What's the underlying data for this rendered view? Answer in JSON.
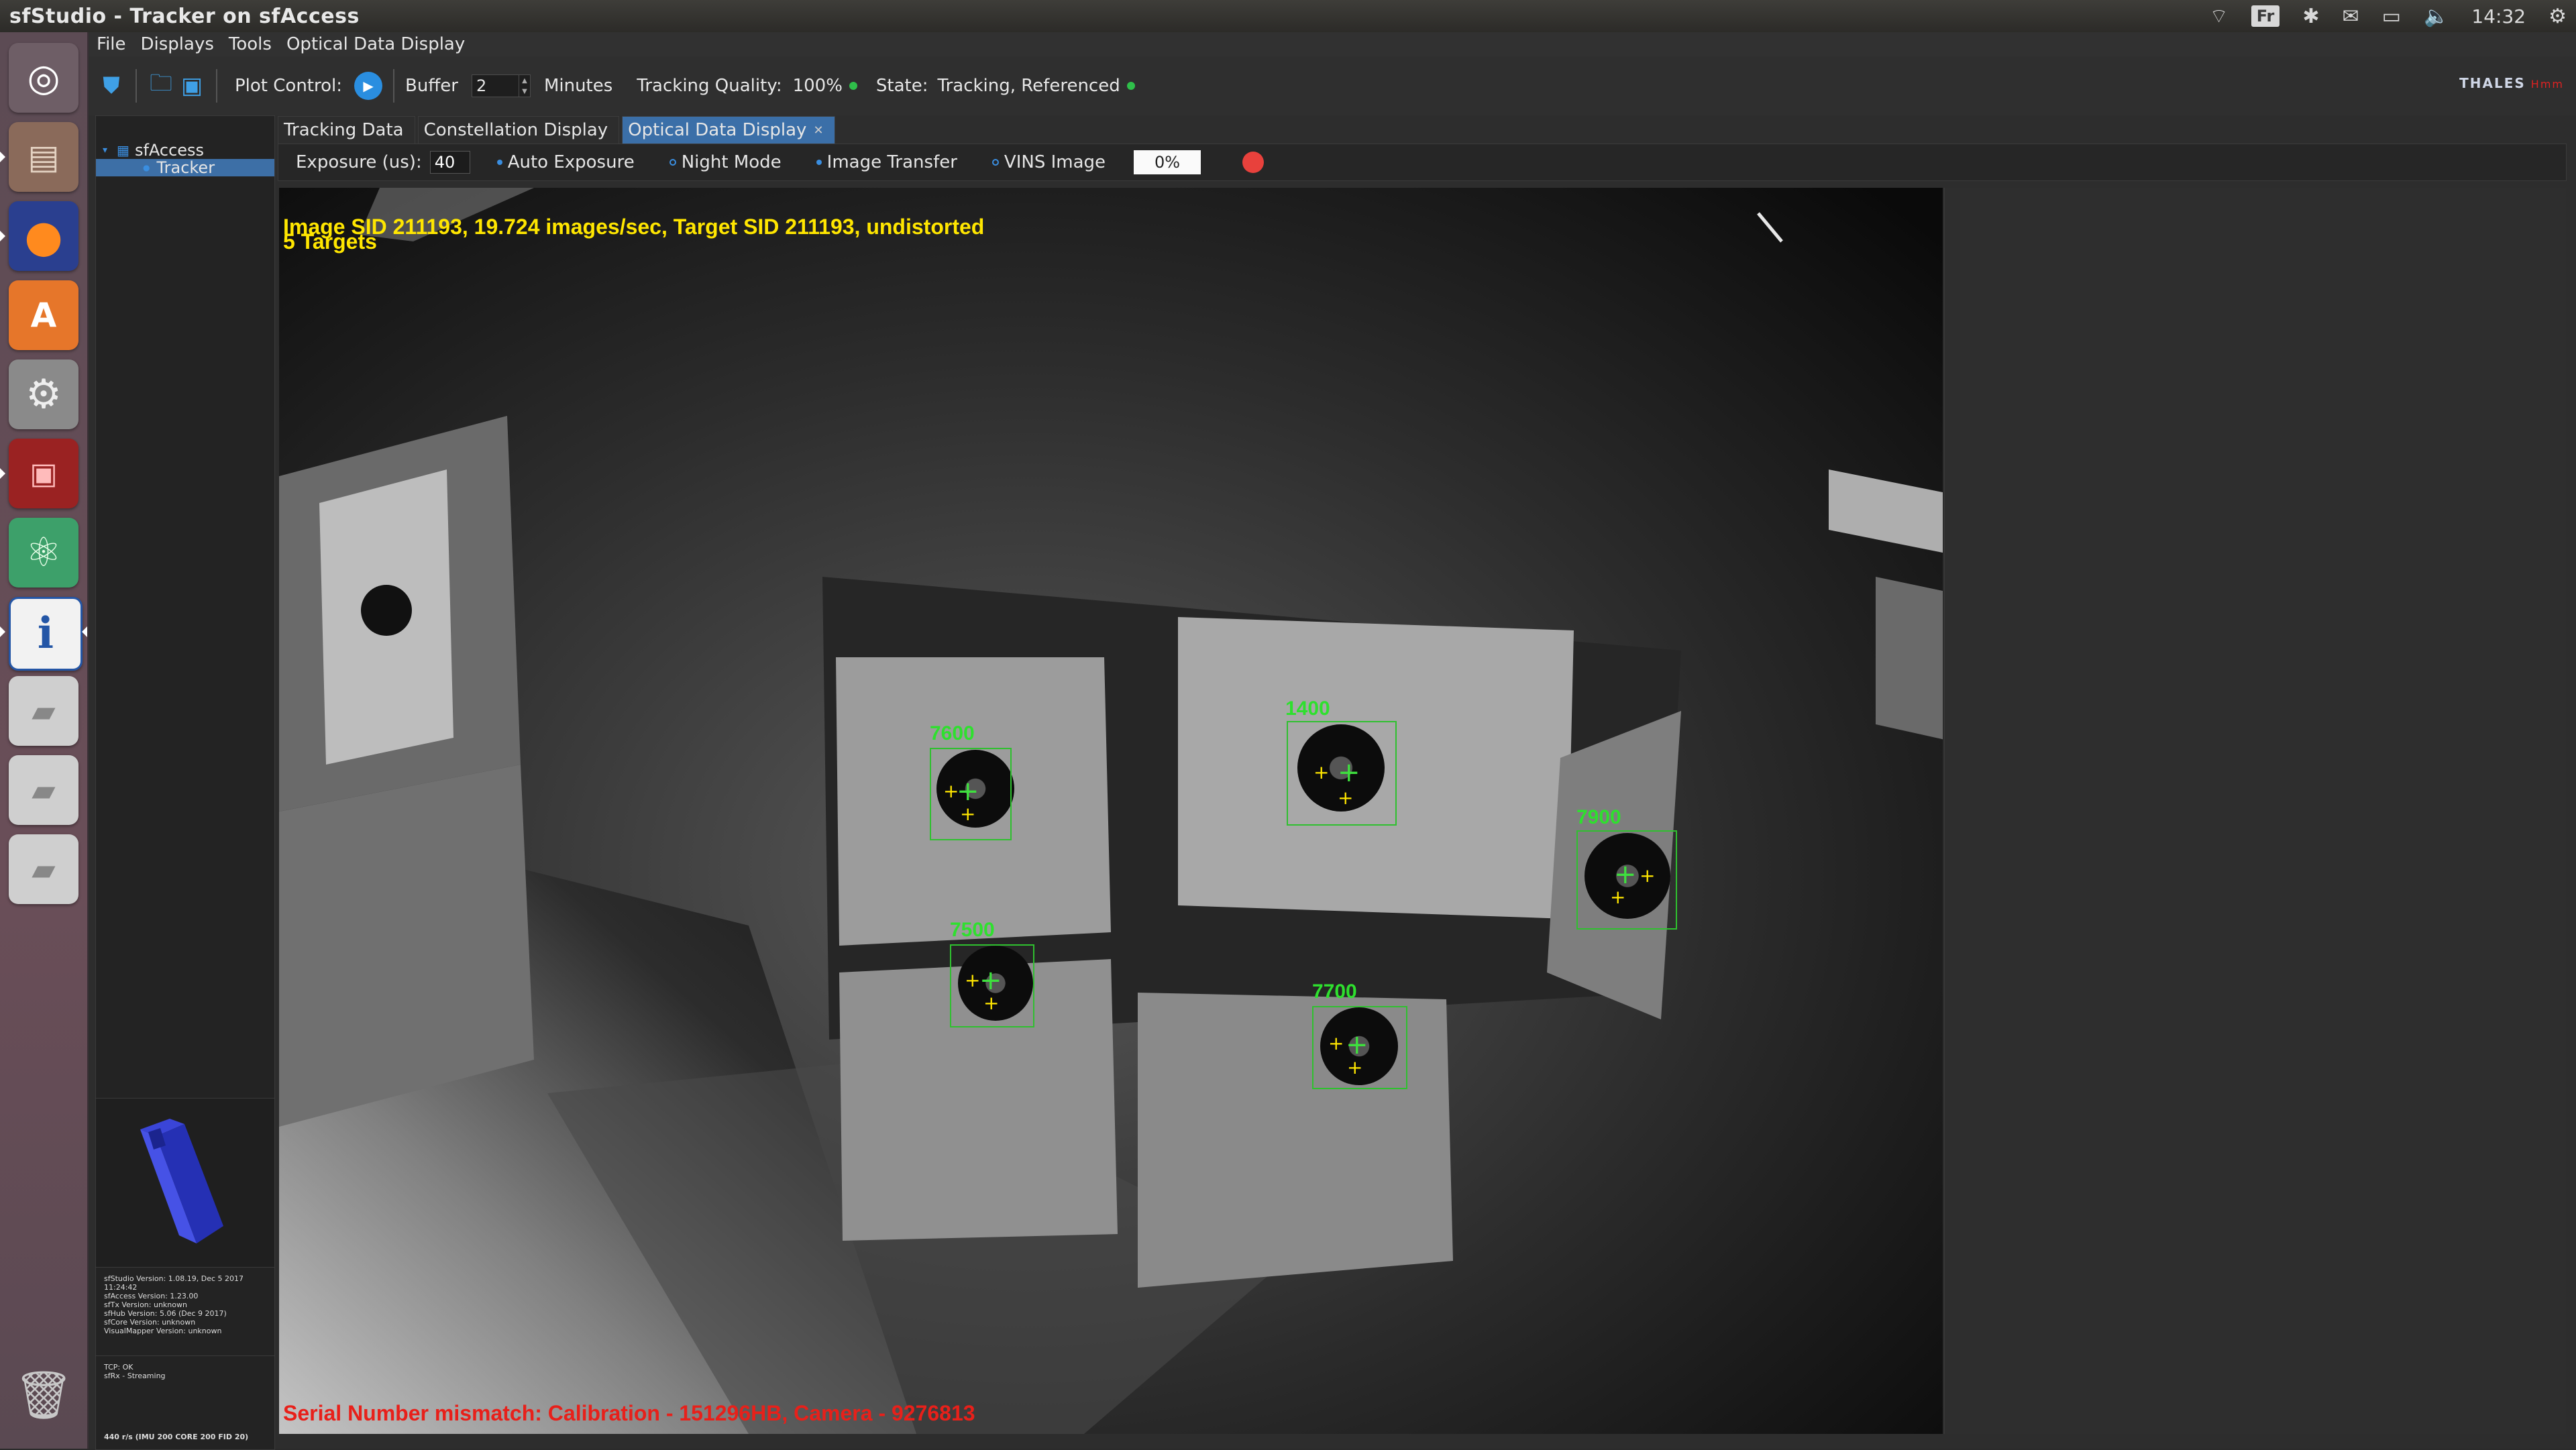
{
  "window": {
    "title": "sfStudio - Tracker on sfAccess"
  },
  "tray": {
    "keyboard": "Fr",
    "time": "14:32"
  },
  "launcher": {
    "items": [
      "ubuntu-dash-icon",
      "files-icon",
      "firefox-icon",
      "software-center-icon",
      "system-settings-icon",
      "terminal-icon",
      "atom-icon",
      "sfstudio-icon",
      "disk-drive-icon",
      "disk-drive-icon",
      "disk-drive-icon",
      "trash-icon"
    ]
  },
  "menubar": {
    "file": "File",
    "displays": "Displays",
    "tools": "Tools",
    "optical": "Optical Data Display"
  },
  "toolbar": {
    "plot_control": "Plot Control:",
    "buffer_label": "Buffer",
    "buffer_value": "2",
    "minutes": "Minutes",
    "tracking_quality_label": "Tracking Quality:",
    "tracking_quality_value": "100%",
    "state_label": "State:",
    "state_value": "Tracking, Referenced",
    "brand": "THALES",
    "brand_sub": "Hmm"
  },
  "tree": {
    "root": "sfAccess",
    "child": "Tracker"
  },
  "versions": [
    "sfStudio Version: 1.08.19, Dec  5 2017",
    "11:24:42",
    "sfAccess Version: 1.23.00",
    "sfTx Version: unknown",
    "sfHub Version: 5.06 (Dec  9 2017)",
    "sfCore Version: unknown",
    "VisualMapper Version: unknown"
  ],
  "status_log": [
    "TCP: OK",
    "sfRx - Streaming"
  ],
  "rates": "440 r/s (IMU 200  CORE 200  FID 20)",
  "tabs": [
    {
      "label": "Tracking Data"
    },
    {
      "label": "Constellation Display"
    },
    {
      "label": "Optical Data Display"
    }
  ],
  "subbar": {
    "exposure_label": "Exposure (us):",
    "exposure_value": "40",
    "auto_exposure": "Auto Exposure",
    "night_mode": "Night Mode",
    "image_transfer": "Image Transfer",
    "vins_image": "VINS Image",
    "percent": "0%"
  },
  "camera": {
    "overlay_line1": "Image SID 211193, 19.724 images/sec, Target SID 211193, undistorted",
    "overlay_line2": "5 Targets",
    "error": "Serial Number mismatch: Calibration - 151296HB, Camera - 9276813",
    "targets": [
      {
        "id": "7600"
      },
      {
        "id": "1400"
      },
      {
        "id": "7900"
      },
      {
        "id": "7500"
      },
      {
        "id": "7700"
      }
    ]
  }
}
